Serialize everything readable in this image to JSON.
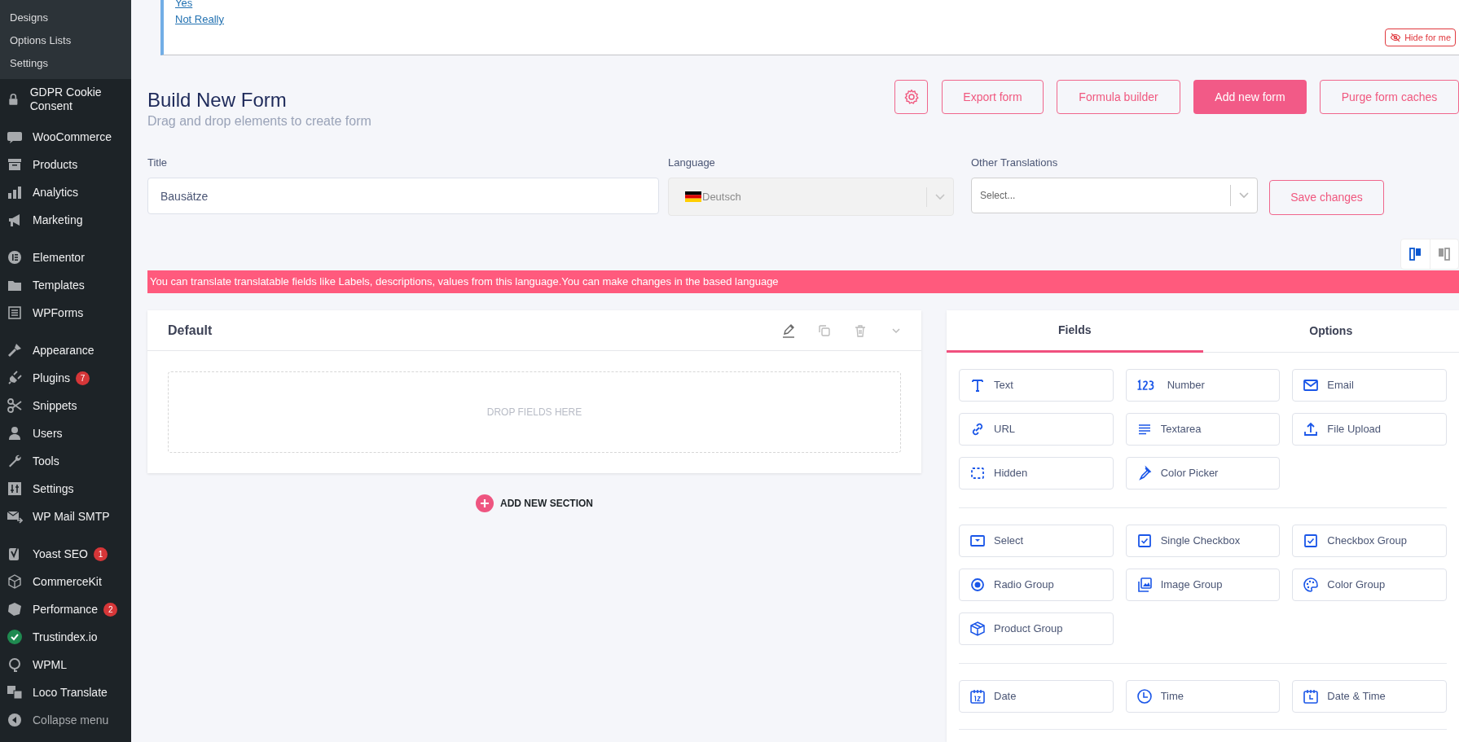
{
  "sidebar": {
    "submenu": [
      "Designs",
      "Options Lists",
      "Settings"
    ],
    "groups": [
      [
        {
          "label": "GDPR Cookie Consent"
        }
      ],
      [
        {
          "label": "WooCommerce"
        },
        {
          "label": "Products"
        },
        {
          "label": "Analytics"
        },
        {
          "label": "Marketing"
        }
      ],
      [
        {
          "label": "Elementor"
        },
        {
          "label": "Templates"
        },
        {
          "label": "WPForms"
        }
      ],
      [
        {
          "label": "Appearance"
        },
        {
          "label": "Plugins",
          "badge": "7"
        },
        {
          "label": "Snippets"
        },
        {
          "label": "Users"
        },
        {
          "label": "Tools"
        },
        {
          "label": "Settings"
        },
        {
          "label": "WP Mail SMTP"
        }
      ],
      [
        {
          "label": "Yoast SEO",
          "badge": "1"
        },
        {
          "label": "CommerceKit"
        },
        {
          "label": "Performance",
          "badge": "2"
        },
        {
          "label": "Trustindex.io"
        },
        {
          "label": "WPML"
        },
        {
          "label": "Loco Translate"
        },
        {
          "label": "Collapse menu",
          "kind": "collapse"
        }
      ]
    ]
  },
  "notice": {
    "links": [
      "Yes",
      "Not Really"
    ],
    "hide_button": "Hide for me"
  },
  "header": {
    "title": "Build New Form",
    "subtitle": "Drag and drop elements to create form",
    "buttons": [
      {
        "label": "Export form",
        "primary": false
      },
      {
        "label": "Formula builder",
        "primary": false
      },
      {
        "label": "Add new form",
        "primary": true
      },
      {
        "label": "Purge form caches",
        "primary": false
      }
    ]
  },
  "form": {
    "title_label": "Title",
    "title_value": "Bausätze",
    "language_label": "Language",
    "language_value": "Deutsch",
    "language_disabled": true,
    "translations_label": "Other Translations",
    "translations_placeholder": "Select...",
    "save_button": "Save changes"
  },
  "layout_toggle": [
    {
      "selected": true
    },
    {
      "selected": false
    }
  ],
  "banner": "You can translate translatable fields like Labels, descriptions, values from this language.You can make changes in the based language",
  "section": {
    "title": "Default",
    "dropzone": "DROP FIELDS HERE",
    "add_section": "ADD NEW SECTION"
  },
  "panel": {
    "tabs": [
      {
        "label": "Fields",
        "selected": true
      },
      {
        "label": "Options",
        "selected": false
      }
    ],
    "field_groups": [
      [
        "Text",
        "Number",
        "Email",
        "URL",
        "Textarea",
        "File Upload",
        "Hidden",
        "Color Picker"
      ],
      [
        "Select",
        "Single Checkbox",
        "Checkbox Group",
        "Radio Group",
        "Image Group",
        "Color Group",
        "Product Group"
      ],
      [
        "Date",
        "Time",
        "Date & Time"
      ]
    ]
  }
}
